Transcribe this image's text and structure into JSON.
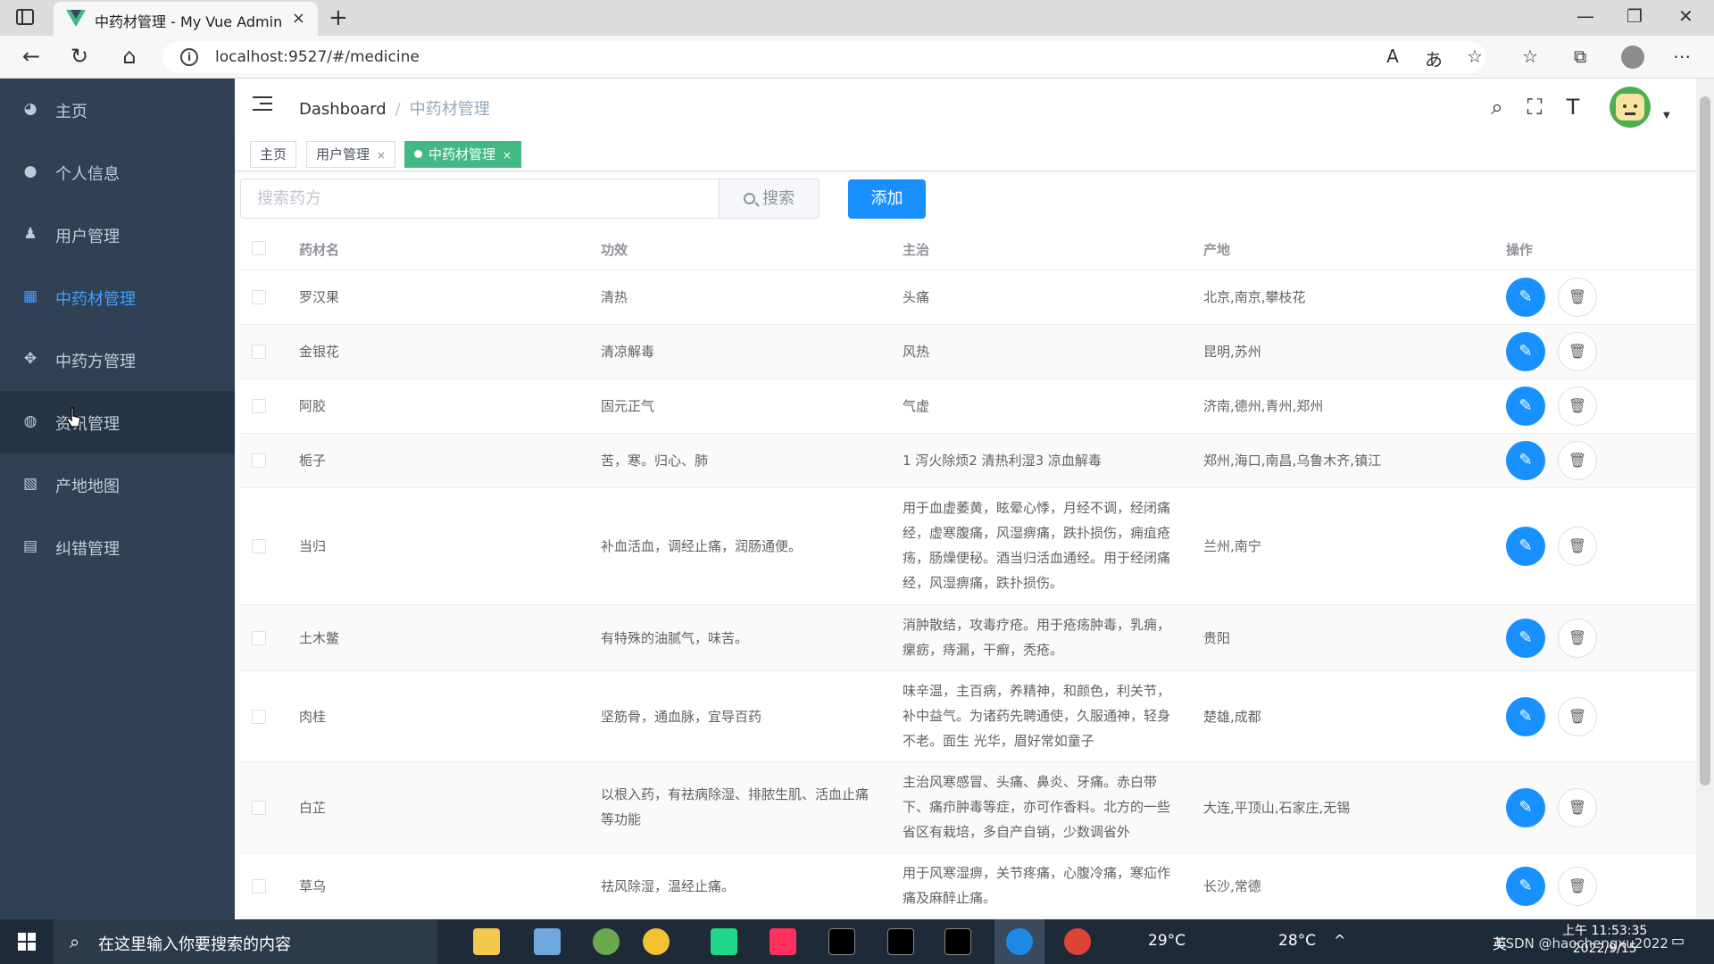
{
  "browser": {
    "tab_title": "中药材管理 - My Vue Admin",
    "tab_close": "×",
    "new_tab": "+",
    "url": "localhost:9527/#/medicine",
    "win_min": "—",
    "win_restore": "❐",
    "win_close": "✕"
  },
  "sidebar": {
    "items": [
      {
        "label": "主页",
        "icon": "dashboard-icon"
      },
      {
        "label": "个人信息",
        "icon": "user-icon"
      },
      {
        "label": "用户管理",
        "icon": "peoples-icon"
      },
      {
        "label": "中药材管理",
        "icon": "grid-icon"
      },
      {
        "label": "中药方管理",
        "icon": "drag-icon"
      },
      {
        "label": "资讯管理",
        "icon": "globe-icon"
      },
      {
        "label": "产地地图",
        "icon": "map-icon"
      },
      {
        "label": "纠错管理",
        "icon": "document-icon"
      }
    ],
    "active_color": "#409eff",
    "background": "#304156"
  },
  "navbar": {
    "breadcrumb_home": "Dashboard",
    "breadcrumb_sep": "/",
    "breadcrumb_current": "中药材管理"
  },
  "tags": [
    {
      "label": "主页",
      "closable": false
    },
    {
      "label": "用户管理",
      "closable": true
    },
    {
      "label": "中药材管理",
      "closable": true,
      "active": true
    }
  ],
  "tag_close": "×",
  "toolbar": {
    "search_placeholder": "搜索药方",
    "search_button": "搜索",
    "add_button": "添加"
  },
  "table": {
    "headers": {
      "name": "药材名",
      "efficacy": "功效",
      "indication": "主治",
      "origin": "产地",
      "actions": "操作"
    },
    "rows": [
      {
        "name": "罗汉果",
        "efficacy": "清热",
        "indication": "头痛",
        "origin": "北京,南京,攀枝花"
      },
      {
        "name": "金银花",
        "efficacy": "清凉解毒",
        "indication": "风热",
        "origin": "昆明,苏州"
      },
      {
        "name": "阿胶",
        "efficacy": "固元正气",
        "indication": "气虚",
        "origin": "济南,德州,青州,郑州"
      },
      {
        "name": "栀子",
        "efficacy": "苦，寒。归心、肺",
        "indication": "1 泻火除烦2 清热利湿3 凉血解毒",
        "origin": "郑州,海口,南昌,乌鲁木齐,镇江"
      },
      {
        "name": "当归",
        "efficacy": "补血活血，调经止痛，润肠通便。",
        "indication": "用于血虚萎黄，眩晕心悸，月经不调，经闭痛经，虚寒腹痛，风湿痹痛，跌扑损伤，痈疽疮疡，肠燥便秘。酒当归活血通经。用于经闭痛经，风湿痹痛，跌扑损伤。",
        "origin": "兰州,南宁"
      },
      {
        "name": "土木鳖",
        "efficacy": "有特殊的油腻气，味苦。",
        "indication": "消肿散结，攻毒疗疮。用于疮疡肿毒，乳痈，瘰疬，痔漏，干癣，秃疮。",
        "origin": "贵阳"
      },
      {
        "name": "肉桂",
        "efficacy": "坚筋骨，通血脉，宜导百药",
        "indication": "味辛温，主百病，养精神，和颜色，利关节，补中益气。为诸药先聘通使，久服通神，轻身不老。面生 光华，眉好常如童子",
        "origin": "楚雄,成都"
      },
      {
        "name": "白芷",
        "efficacy": "以根入药，有祛病除湿、排脓生肌、活血止痛等功能",
        "indication": "主治风寒感冒、头痛、鼻炎、牙痛。赤白带下、痛疖肿毒等症，亦可作香料。北方的一些省区有栽培，多自产自销，少数调省外",
        "origin": "大连,平顶山,石家庄,无锡"
      },
      {
        "name": "草乌",
        "efficacy": "祛风除湿，温经止痛。",
        "indication": "用于风寒湿痹，关节疼痛，心腹冷痛，寒疝作痛及麻醉止痛。",
        "origin": "长沙,常德"
      }
    ]
  },
  "taskbar": {
    "search_text": "在这里输入你要搜索的内容",
    "weather1": "29°C",
    "weather2": "28°C",
    "ime": "英",
    "time": "上午 11:53:35",
    "date": "2022/9/15",
    "watermark": "CSDN @haochengxu2022"
  }
}
